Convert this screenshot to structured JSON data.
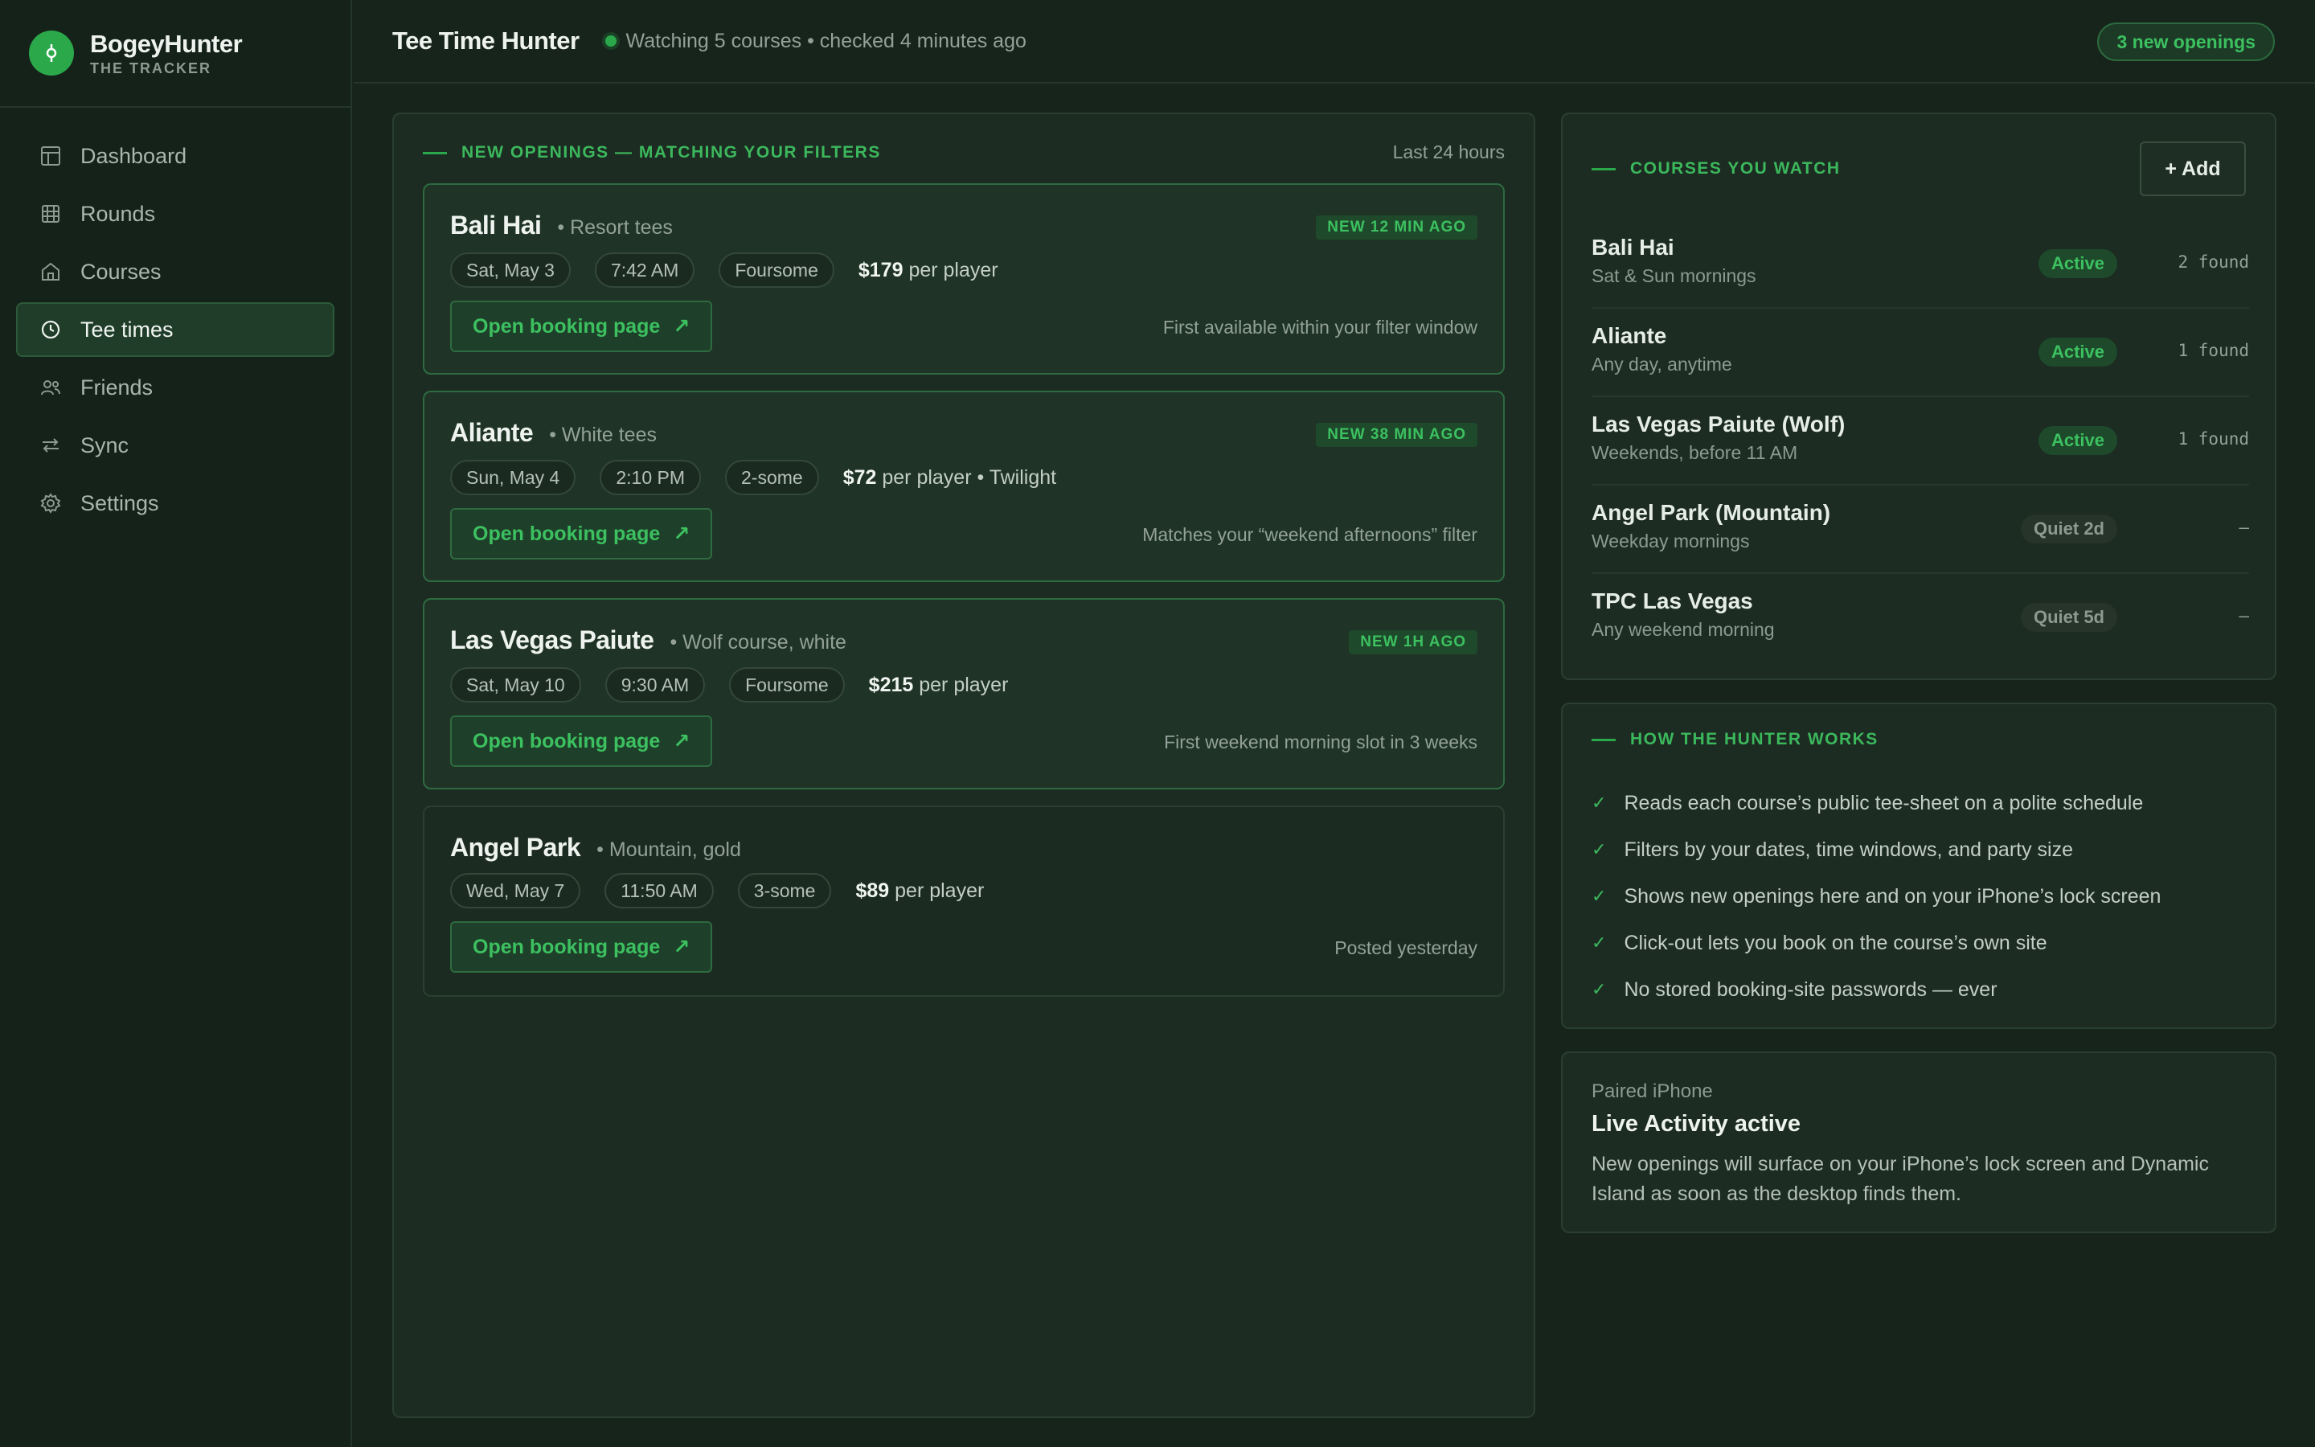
{
  "brand": {
    "name": "BogeyHunter",
    "sub": "THE TRACKER"
  },
  "nav": [
    {
      "label": "Dashboard",
      "icon": "dashboard-icon"
    },
    {
      "label": "Rounds",
      "icon": "rounds-icon"
    },
    {
      "label": "Courses",
      "icon": "courses-icon"
    },
    {
      "label": "Tee times",
      "icon": "clock-icon",
      "active": true
    },
    {
      "label": "Friends",
      "icon": "friends-icon"
    },
    {
      "label": "Sync",
      "icon": "sync-icon"
    },
    {
      "label": "Settings",
      "icon": "gear-icon"
    }
  ],
  "header": {
    "title": "Tee Time Hunter",
    "status": "Watching 5 courses • checked 4 minutes ago",
    "badge": "3 new openings"
  },
  "openings": {
    "label": "NEW OPENINGS — MATCHING YOUR FILTERS",
    "range": "Last 24 hours",
    "book_label": "Open booking page",
    "cards": [
      {
        "name": "Bali Hai",
        "sub": "• Resort tees",
        "new": "NEW 12 MIN AGO",
        "date": "Sat, May 3",
        "time": "7:42 AM",
        "party": "Foursome",
        "price": "$179",
        "price_rest": " per player",
        "note": "First available within your filter window"
      },
      {
        "name": "Aliante",
        "sub": "• White tees",
        "new": "NEW 38 MIN AGO",
        "date": "Sun, May 4",
        "time": "2:10 PM",
        "party": "2-some",
        "price": "$72",
        "price_rest": " per player • Twilight",
        "note": "Matches your “weekend afternoons” filter"
      },
      {
        "name": "Las Vegas Paiute",
        "sub": "• Wolf course, white",
        "new": "NEW 1H AGO",
        "date": "Sat, May 10",
        "time": "9:30 AM",
        "party": "Foursome",
        "price": "$215",
        "price_rest": " per player",
        "note": "First weekend morning slot in 3 weeks"
      },
      {
        "name": "Angel Park",
        "sub": "• Mountain, gold",
        "new": "",
        "date": "Wed, May 7",
        "time": "11:50 AM",
        "party": "3-some",
        "price": "$89",
        "price_rest": " per player",
        "note": "Posted yesterday"
      }
    ]
  },
  "watch": {
    "label": "COURSES YOU WATCH",
    "add_label": "+ Add",
    "courses": [
      {
        "name": "Bali Hai",
        "when": "Sat & Sun mornings",
        "status": "Active",
        "found": "2 found"
      },
      {
        "name": "Aliante",
        "when": "Any day, anytime",
        "status": "Active",
        "found": "1 found"
      },
      {
        "name": "Las Vegas Paiute (Wolf)",
        "when": "Weekends, before 11 AM",
        "status": "Active",
        "found": "1 found"
      },
      {
        "name": "Angel Park (Mountain)",
        "when": "Weekday mornings",
        "status": "Quiet 2d",
        "found": "–"
      },
      {
        "name": "TPC Las Vegas",
        "when": "Any weekend morning",
        "status": "Quiet 5d",
        "found": "–"
      }
    ]
  },
  "how": {
    "label": "HOW THE HUNTER WORKS",
    "items": [
      "Reads each course’s public tee-sheet on a polite schedule",
      "Filters by your dates, time windows, and party size",
      "Shows new openings here and on your iPhone’s lock screen",
      "Click-out lets you book on the course’s own site",
      "No stored booking-site passwords — ever"
    ]
  },
  "iphone": {
    "label": "Paired iPhone",
    "title": "Live Activity active",
    "desc": "New openings will surface on your iPhone’s lock screen and Dynamic Island as soon as the desktop finds them."
  },
  "colors": {
    "accent": "#2ba84a",
    "accent_text": "#3cc060",
    "bg": "#17241c"
  }
}
